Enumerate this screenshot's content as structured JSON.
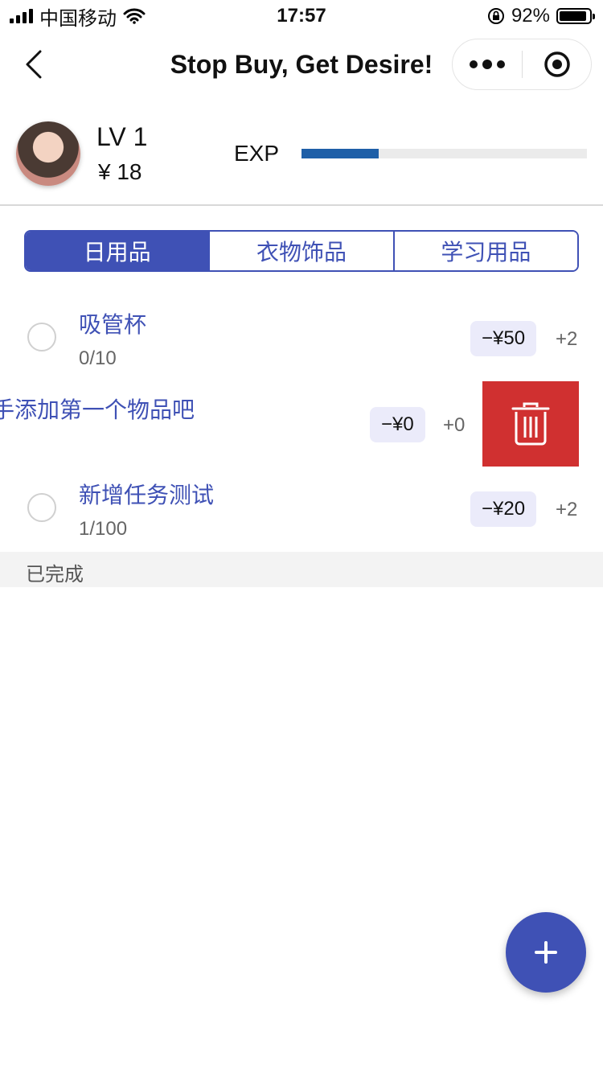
{
  "status_bar": {
    "carrier": "中国移动",
    "time": "17:57",
    "battery_text": "92%",
    "battery_level": 0.92,
    "icons": [
      "signal-icon",
      "wifi-icon",
      "orientation-lock-icon",
      "battery-icon"
    ]
  },
  "nav": {
    "title": "Stop Buy, Get Desire!",
    "icons": [
      "back-chevron-icon",
      "more-dots-icon",
      "close-target-icon"
    ]
  },
  "profile": {
    "level": "LV 1",
    "money": "¥  18",
    "exp_label": "EXP",
    "exp_progress": 0.27
  },
  "tabs": [
    {
      "label": "日用品",
      "active": true
    },
    {
      "label": "衣物饰品",
      "active": false
    },
    {
      "label": "学习用品",
      "active": false
    }
  ],
  "items": [
    {
      "name": "吸管杯",
      "progress": "0/10",
      "price": "−¥50",
      "exp": "+2"
    },
    {
      "name": "手添加第一个物品吧",
      "progress": "",
      "price": "−¥0",
      "exp": "+0",
      "swiped": true
    },
    {
      "name": "新增任务测试",
      "progress": "1/100",
      "price": "−¥20",
      "exp": "+2"
    }
  ],
  "delete_icon": "trash-icon",
  "completed_section": {
    "label": "已完成"
  },
  "fab": {
    "icon": "plus-icon"
  },
  "colors": {
    "primary": "#3f51b5",
    "exp_bar": "#1e5fa8",
    "delete": "#d03030",
    "price_bg": "#ebebfa"
  }
}
